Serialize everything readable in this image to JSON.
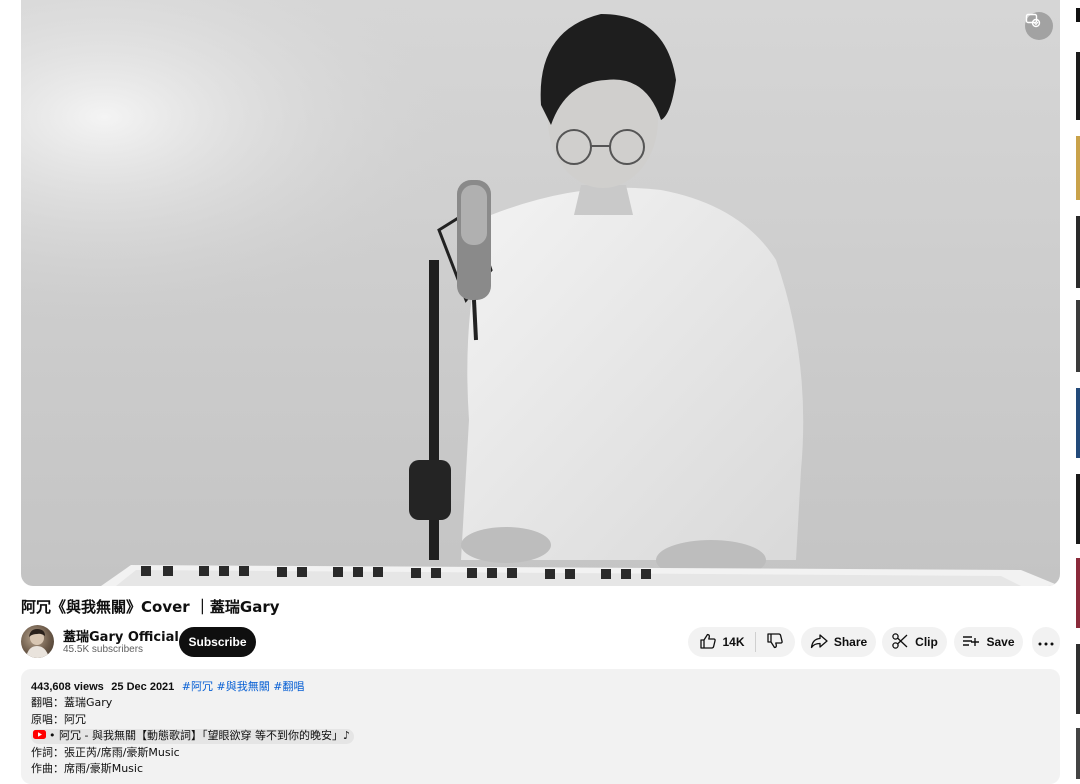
{
  "video": {
    "title": "阿冗《與我無關》Cover ｜蓋瑞Gary"
  },
  "channel": {
    "name": "蓋瑞Gary Official",
    "subscribers": "45.5K subscribers",
    "subscribe_label": "Subscribe"
  },
  "actions": {
    "like_count": "14K",
    "share_label": "Share",
    "clip_label": "Clip",
    "save_label": "Save"
  },
  "description": {
    "views": "443,608 views",
    "date": "25 Dec 2021",
    "hashtags": [
      "#阿冗",
      "#與我無關",
      "#翻唱"
    ],
    "lines": [
      "翻唱：蓋瑞Gary",
      "原唱：阿冗"
    ],
    "linked_video": "• 阿冗 - 與我無關【動態歌詞】「望眼欲穿 等不到你的晚安」♪",
    "credits": [
      "作詞：張正芮/席雨/豪斯Music",
      "作曲：席雨/豪斯Music"
    ]
  },
  "icons": {
    "cast": "cast-icon",
    "like": "thumbs-up-icon",
    "dislike": "thumbs-down-icon",
    "share": "share-arrow-icon",
    "clip": "scissors-icon",
    "save": "playlist-add-icon",
    "more": "more-horizontal-icon",
    "youtube": "youtube-logo-icon"
  },
  "colors": {
    "subscribe_bg": "#0f0f0f",
    "pill_bg": "#f2f2f2",
    "hashtag": "#065fd4",
    "youtube_red": "#ff0000"
  }
}
